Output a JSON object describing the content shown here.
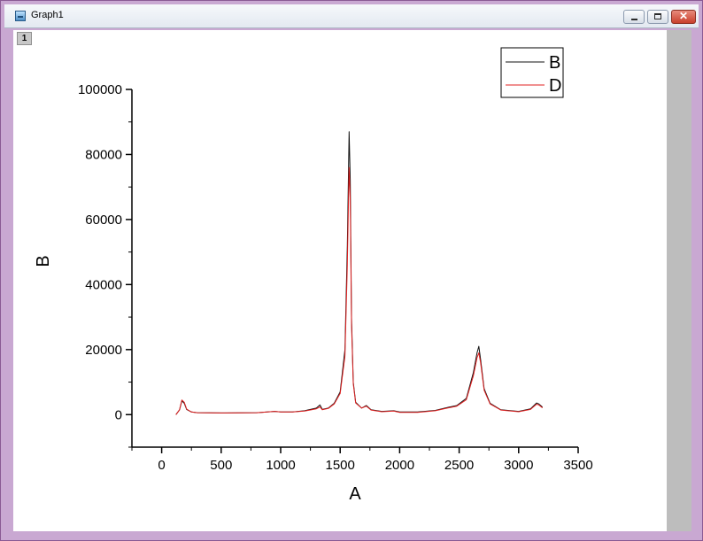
{
  "window": {
    "title": "Graph1",
    "layer_tab": "1",
    "buttons": {
      "minimize": "minimize",
      "restore": "restore",
      "close": "x"
    }
  },
  "colors": {
    "series_b": "#111111",
    "series_d": "#e02020",
    "axis": "#000000"
  },
  "chart_data": {
    "type": "line",
    "xlabel": "A",
    "ylabel": "B",
    "xlim": [
      -250,
      3500
    ],
    "ylim": [
      -10000,
      100000
    ],
    "x_ticks": [
      0,
      500,
      1000,
      1500,
      2000,
      2500,
      3000,
      3500
    ],
    "y_ticks": [
      0,
      20000,
      40000,
      60000,
      80000,
      100000
    ],
    "x_tick_labels": [
      "0",
      "500",
      "1000",
      "1500",
      "2000",
      "2500",
      "3000",
      "3500"
    ],
    "y_tick_labels": [
      "0",
      "20000",
      "40000",
      "60000",
      "80000",
      "100000"
    ],
    "legend_position": "top-right",
    "grid": false,
    "series": [
      {
        "name": "B",
        "x": [
          120,
          150,
          170,
          190,
          210,
          250,
          300,
          500,
          800,
          950,
          1000,
          1100,
          1200,
          1300,
          1330,
          1350,
          1400,
          1450,
          1500,
          1540,
          1560,
          1575,
          1585,
          1595,
          1610,
          1630,
          1680,
          1720,
          1760,
          1850,
          1950,
          2000,
          2150,
          2300,
          2400,
          2480,
          2560,
          2620,
          2650,
          2665,
          2680,
          2710,
          2760,
          2850,
          3000,
          3100,
          3150,
          3170,
          3200
        ],
        "y": [
          0,
          1500,
          4200,
          3500,
          1600,
          800,
          600,
          500,
          600,
          1000,
          800,
          800,
          1200,
          2000,
          3000,
          1600,
          2000,
          3500,
          7000,
          20000,
          52000,
          87000,
          72000,
          30000,
          10000,
          3800,
          2000,
          2800,
          1500,
          1000,
          1200,
          800,
          800,
          1300,
          2200,
          2800,
          5000,
          13000,
          19000,
          21000,
          17000,
          8000,
          3500,
          1500,
          1000,
          1800,
          3600,
          3300,
          2300
        ]
      },
      {
        "name": "D",
        "x": [
          120,
          150,
          170,
          190,
          210,
          250,
          300,
          500,
          800,
          950,
          1000,
          1100,
          1200,
          1300,
          1330,
          1350,
          1400,
          1450,
          1500,
          1540,
          1560,
          1575,
          1585,
          1595,
          1610,
          1630,
          1680,
          1720,
          1760,
          1850,
          1950,
          2000,
          2150,
          2300,
          2400,
          2480,
          2560,
          2620,
          2650,
          2665,
          2680,
          2710,
          2760,
          2850,
          3000,
          3100,
          3150,
          3170,
          3200
        ],
        "y": [
          0,
          1500,
          4500,
          3800,
          1700,
          800,
          600,
          500,
          600,
          1000,
          800,
          800,
          1100,
          1800,
          2400,
          1500,
          1900,
          3300,
          6500,
          18000,
          46000,
          76000,
          66000,
          28000,
          9500,
          3600,
          2000,
          2600,
          1400,
          900,
          1100,
          700,
          700,
          1200,
          2000,
          2600,
          4600,
          12000,
          17500,
          19000,
          16000,
          7500,
          3300,
          1400,
          900,
          1600,
          3200,
          3000,
          2100
        ]
      }
    ]
  }
}
